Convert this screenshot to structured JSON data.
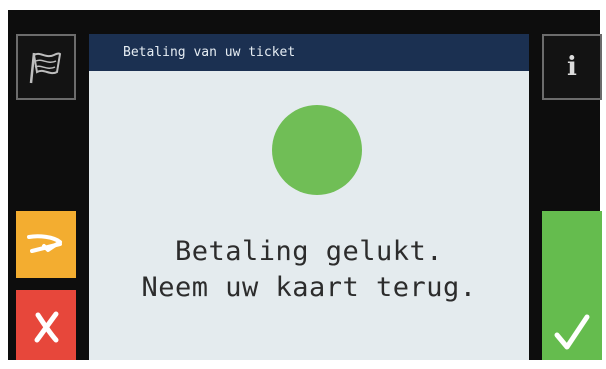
{
  "header": {
    "title": "Betaling van uw ticket"
  },
  "status": {
    "indicator_color": "#70be56",
    "message_line1": "Betaling gelukt.",
    "message_line2": "Neem uw kaart terug."
  },
  "buttons": {
    "language": {
      "icon": "flag-icon"
    },
    "info": {
      "icon": "info-icon",
      "label": "i"
    },
    "back": {
      "icon": "return-arrow-icon",
      "color": "#f3ad30"
    },
    "cancel": {
      "icon": "cross-icon",
      "color": "#e7473b"
    },
    "confirm": {
      "icon": "checkmark-icon",
      "color": "#65bc4e"
    }
  }
}
